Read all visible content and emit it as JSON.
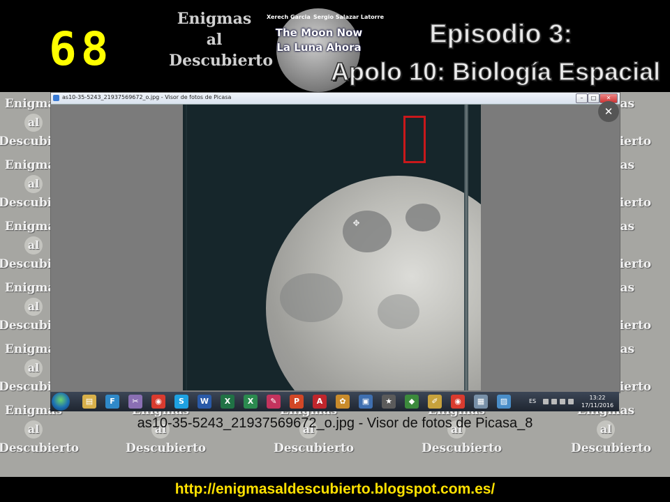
{
  "slide": {
    "number": "68"
  },
  "logo": {
    "line1": "Enigmas",
    "line2": "al",
    "line3": "Descubierto"
  },
  "moon_badge": {
    "author1": "Xerech Garcia",
    "author2": "Sergio Salazar Latorre",
    "title_en": "The Moon Now",
    "title_es": "La Luna Ahora"
  },
  "episode": {
    "label": "Episodio 3:",
    "title": "Apolo 10: Biología Espacial"
  },
  "window": {
    "title": "as10-35-5243_21937569672_o.jpg - Visor de fotos de Picasa",
    "min": "–",
    "max": "□",
    "close": "✕"
  },
  "viewer": {
    "close": "✕"
  },
  "taskbar": {
    "apps": [
      {
        "name": "explorer",
        "glyph": "▤",
        "color": "#d8b04a"
      },
      {
        "name": "app-f",
        "glyph": "F",
        "color": "#2f89c9"
      },
      {
        "name": "tool",
        "glyph": "✂",
        "color": "#8a6fb3"
      },
      {
        "name": "chrome",
        "glyph": "◉",
        "color": "#d93b2f"
      },
      {
        "name": "skype",
        "glyph": "S",
        "color": "#1ea1e1"
      },
      {
        "name": "word",
        "glyph": "W",
        "color": "#2a5aa8"
      },
      {
        "name": "excel",
        "glyph": "X",
        "color": "#207245"
      },
      {
        "name": "excel2",
        "glyph": "X",
        "color": "#2b8a4f"
      },
      {
        "name": "pen",
        "glyph": "✎",
        "color": "#c4335d"
      },
      {
        "name": "powerpoint",
        "glyph": "P",
        "color": "#d24726"
      },
      {
        "name": "acrobat",
        "glyph": "A",
        "color": "#c0262c"
      },
      {
        "name": "paint",
        "glyph": "✿",
        "color": "#c98b2b"
      },
      {
        "name": "save",
        "glyph": "▣",
        "color": "#3f6fb0"
      },
      {
        "name": "movie",
        "glyph": "★",
        "color": "#5b5b5b"
      },
      {
        "name": "media",
        "glyph": "◆",
        "color": "#3c8a3c"
      },
      {
        "name": "draw",
        "glyph": "✐",
        "color": "#c7a23c"
      },
      {
        "name": "chrome2",
        "glyph": "◉",
        "color": "#d93b2f"
      },
      {
        "name": "doc",
        "glyph": "▦",
        "color": "#7890a8"
      },
      {
        "name": "picasa",
        "glyph": "▨",
        "color": "#4a8ec9"
      }
    ],
    "lang": "ES",
    "time": "13:22",
    "date": "17/11/2016"
  },
  "watermark": {
    "line1": "Enigmas",
    "line2": "al",
    "line3": "Descubierto"
  },
  "caption": "as10-35-5243_21937569672_o.jpg - Visor de fotos de Picasa_8",
  "footer": {
    "url": "http://enigmasaldescubierto.blogspot.com.es/"
  }
}
